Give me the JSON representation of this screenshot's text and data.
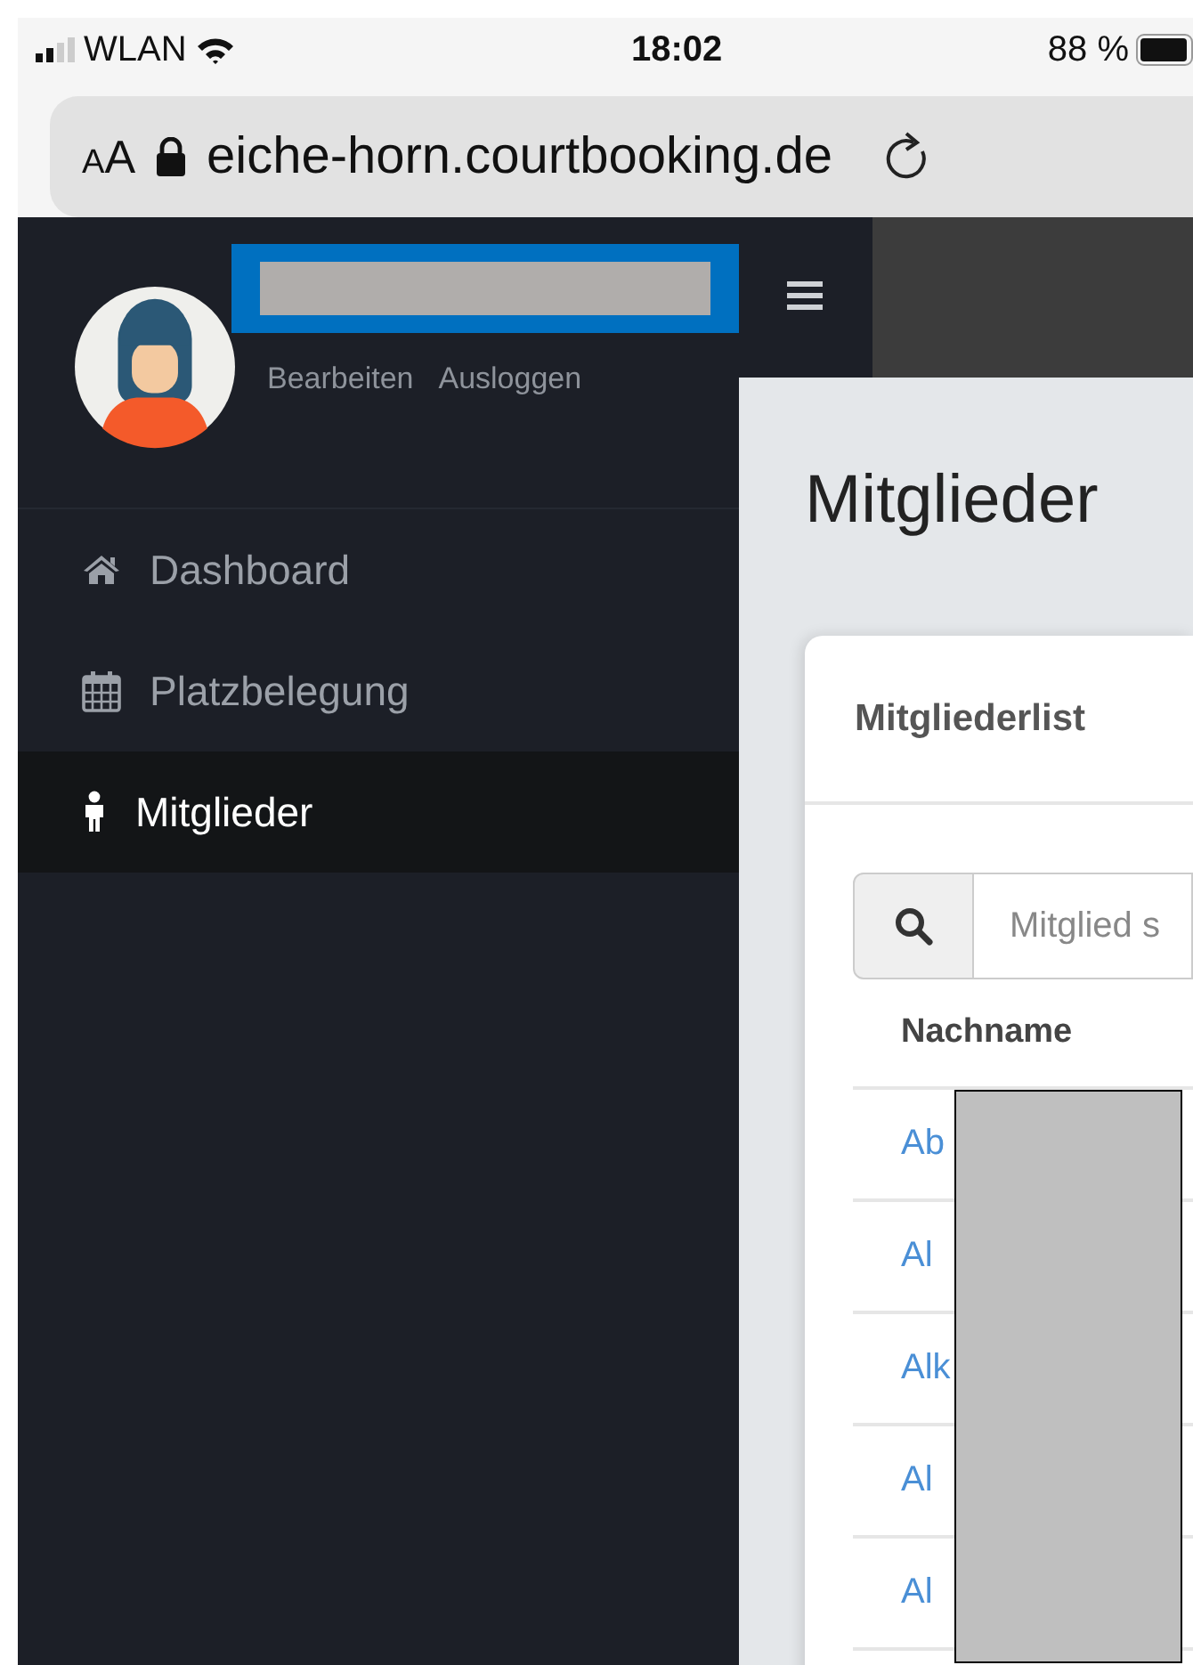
{
  "status_bar": {
    "carrier": "WLAN",
    "time": "18:02",
    "battery": "88 %"
  },
  "browser": {
    "text_size_button": "AA",
    "url": "eiche-horn.courtbooking.de"
  },
  "sidebar": {
    "profile_links": [
      "Bearbeiten",
      "Ausloggen"
    ],
    "items": [
      {
        "label": "Dashboard",
        "selected": false
      },
      {
        "label": "Platzbelegung",
        "selected": false
      },
      {
        "label": "Mitglieder",
        "selected": true
      }
    ]
  },
  "page": {
    "title": "Mitglieder",
    "card_title": "Mitgliederlist",
    "search": {
      "placeholder": "Mitglied s"
    },
    "table": {
      "columns": [
        "Nachname"
      ],
      "rows": [
        "Ab",
        "Al",
        "Alk",
        "Al",
        "Al"
      ]
    }
  }
}
